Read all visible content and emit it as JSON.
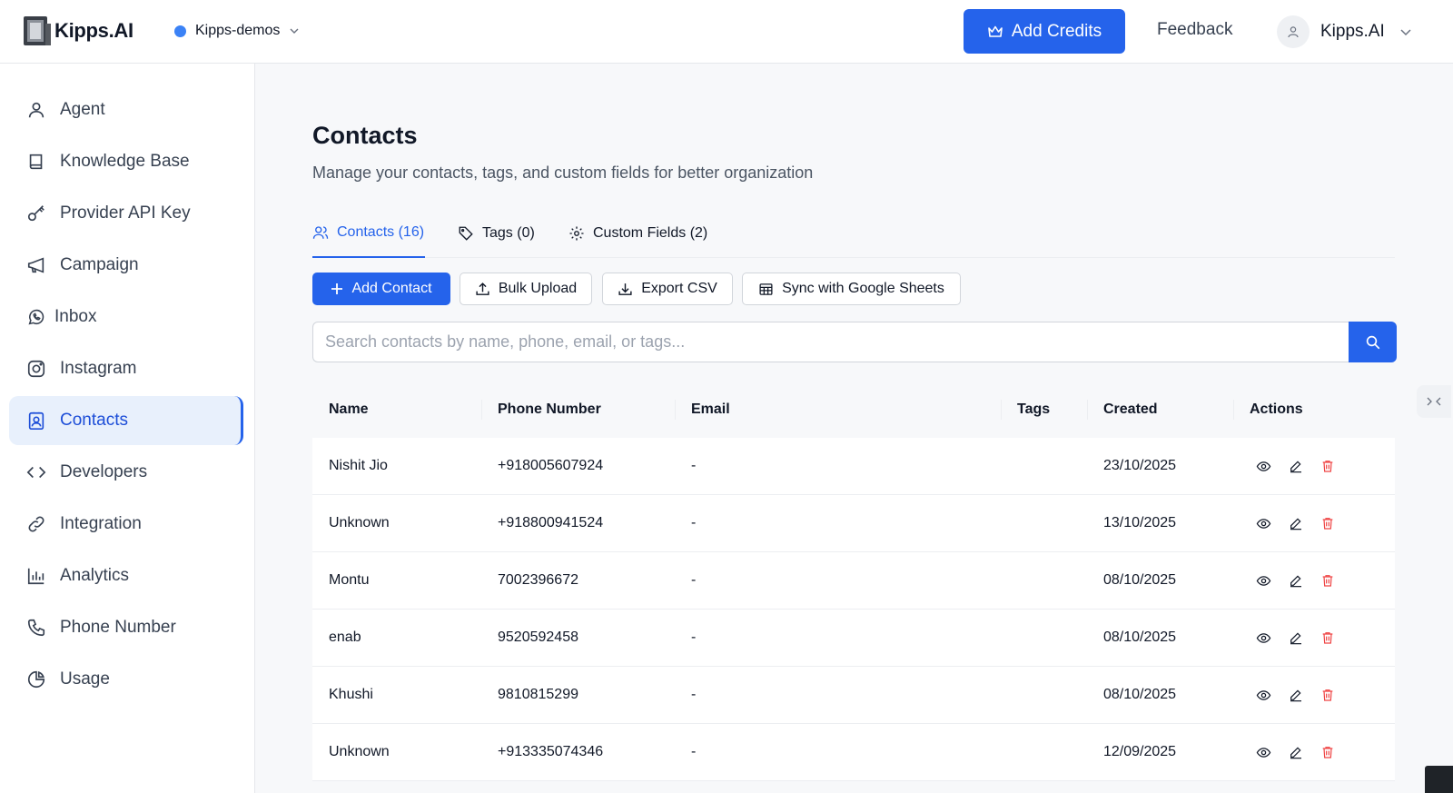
{
  "header": {
    "logo_text": "Kipps.AI",
    "workspace_name": "Kipps-demos",
    "add_credits_label": "Add Credits",
    "feedback_label": "Feedback",
    "user_name": "Kipps.AI"
  },
  "sidebar": {
    "items": [
      {
        "label": "Agent",
        "icon": "user-icon"
      },
      {
        "label": "Knowledge Base",
        "icon": "book-icon"
      },
      {
        "label": "Provider API Key",
        "icon": "key-icon"
      },
      {
        "label": "Campaign",
        "icon": "megaphone-icon"
      },
      {
        "label": "Inbox",
        "icon": "whatsapp-icon"
      },
      {
        "label": "Instagram",
        "icon": "instagram-icon"
      },
      {
        "label": "Contacts",
        "icon": "contact-card-icon",
        "active": true
      },
      {
        "label": "Developers",
        "icon": "code-icon"
      },
      {
        "label": "Integration",
        "icon": "link-icon"
      },
      {
        "label": "Analytics",
        "icon": "bar-chart-icon"
      },
      {
        "label": "Phone Number",
        "icon": "phone-icon"
      },
      {
        "label": "Usage",
        "icon": "pie-chart-icon"
      }
    ]
  },
  "page": {
    "title": "Contacts",
    "subtitle": "Manage your contacts, tags, and custom fields for better organization"
  },
  "tabs": [
    {
      "label": "Contacts (16)",
      "icon": "users-icon",
      "active": true
    },
    {
      "label": "Tags (0)",
      "icon": "tag-icon"
    },
    {
      "label": "Custom Fields (2)",
      "icon": "gear-icon"
    }
  ],
  "toolbar": {
    "add_contact": "Add Contact",
    "bulk_upload": "Bulk Upload",
    "export_csv": "Export CSV",
    "sync_sheets": "Sync with Google Sheets"
  },
  "search": {
    "placeholder": "Search contacts by name, phone, email, or tags...",
    "value": ""
  },
  "table": {
    "columns": [
      "Name",
      "Phone Number",
      "Email",
      "Tags",
      "Created",
      "Actions"
    ],
    "rows": [
      {
        "name": "Nishit Jio",
        "phone": "+918005607924",
        "email": "-",
        "tags": "",
        "created": "23/10/2025"
      },
      {
        "name": "Unknown",
        "phone": "+918800941524",
        "email": "-",
        "tags": "",
        "created": "13/10/2025"
      },
      {
        "name": "Montu",
        "phone": "7002396672",
        "email": "-",
        "tags": "",
        "created": "08/10/2025"
      },
      {
        "name": "enab",
        "phone": "9520592458",
        "email": "-",
        "tags": "",
        "created": "08/10/2025"
      },
      {
        "name": "Khushi",
        "phone": "9810815299",
        "email": "-",
        "tags": "",
        "created": "08/10/2025"
      },
      {
        "name": "Unknown",
        "phone": "+913335074346",
        "email": "-",
        "tags": "",
        "created": "12/09/2025"
      }
    ]
  },
  "colors": {
    "accent": "#2563eb",
    "danger": "#ef4444",
    "active_bg": "#e8f0fc",
    "workspace_dot": "#3b82f6"
  }
}
